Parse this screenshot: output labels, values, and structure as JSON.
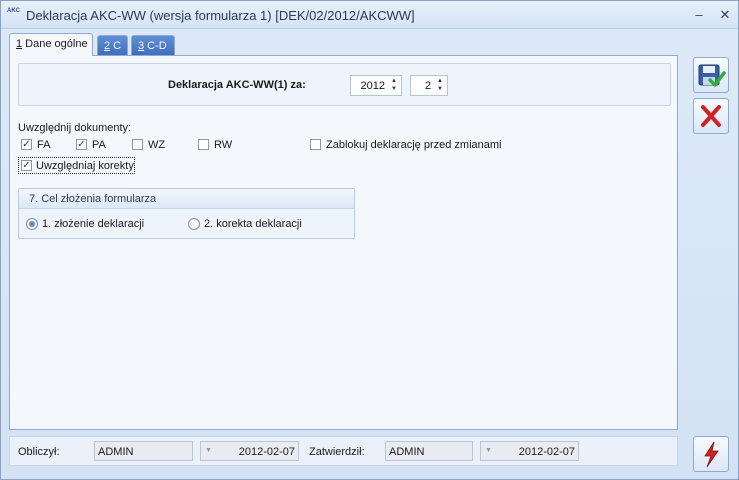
{
  "window": {
    "title": "Deklaracja AKC-WW (wersja formularza 1) [DEK/02/2012/AKCWW]",
    "logo_text": "AKC",
    "minimize_icon": "minimize-icon",
    "close_icon": "close-icon"
  },
  "tabs": [
    {
      "hotkey": "1",
      "label": " Dane ogólne"
    },
    {
      "hotkey": "2",
      "label": " C"
    },
    {
      "hotkey": "3",
      "label": " C-D"
    }
  ],
  "header": {
    "label": "Deklaracja AKC-WW(1) za:",
    "year": "2012",
    "month": "2"
  },
  "documents": {
    "label": "Uwzględnij dokumenty:",
    "items": [
      {
        "label": "FA",
        "checked": true
      },
      {
        "label": "PA",
        "checked": true
      },
      {
        "label": "WZ",
        "checked": false
      },
      {
        "label": "RW",
        "checked": false
      }
    ],
    "lock_label": "Zablokuj deklarację przed zmianami",
    "lock_checked": false,
    "corrections_label": "Uwzględniaj korekty",
    "corrections_checked": true
  },
  "purpose": {
    "title": "7. Cel złożenia formularza",
    "options": [
      {
        "label": "1. złożenie deklaracji",
        "selected": true
      },
      {
        "label": "2. korekta deklaracji",
        "selected": false
      }
    ]
  },
  "side_buttons": {
    "save_icon": "save-confirm-icon",
    "cancel_icon": "cancel-x-icon",
    "calculate_icon": "lightning-icon"
  },
  "footer": {
    "calculated_label": "Obliczył:",
    "calculated_by": "ADMIN",
    "calculated_date": "2012-02-07",
    "approved_label": "Zatwierdził:",
    "approved_by": "ADMIN",
    "approved_date": "2012-02-07"
  },
  "colors": {
    "accent": "#3e6fbf",
    "cancel": "#d42020",
    "lightning": "#d42020"
  }
}
